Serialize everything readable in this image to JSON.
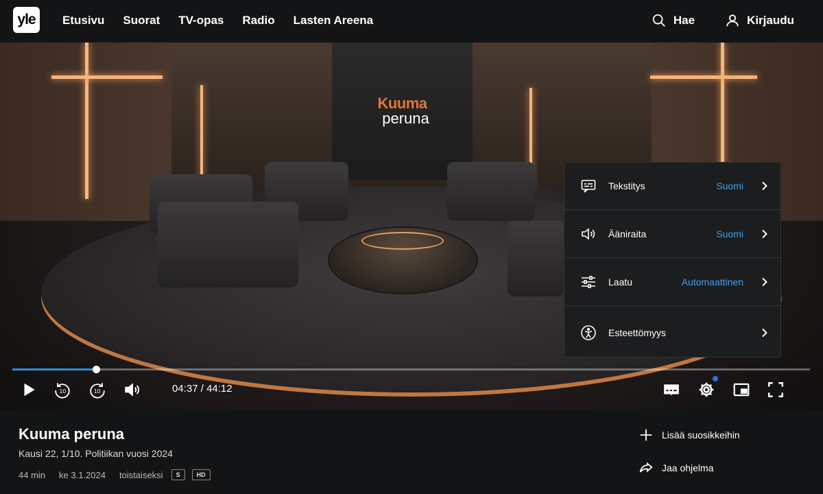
{
  "brand": {
    "logo_text": "yle"
  },
  "nav": {
    "items": [
      "Etusivu",
      "Suorat",
      "TV-opas",
      "Radio",
      "Lasten Areena"
    ],
    "search_label": "Hae",
    "login_label": "Kirjaudu"
  },
  "video": {
    "show_logo_line1": "Kuuma",
    "show_logo_line2": "peruna",
    "progress_fraction": 0.105,
    "current_time": "04:37",
    "time_separator": "/",
    "duration": "44:12"
  },
  "settings_menu": {
    "items": [
      {
        "icon": "subtitles-icon",
        "label": "Tekstitys",
        "value": "Suomi"
      },
      {
        "icon": "speaker-icon",
        "label": "Ääniraita",
        "value": "Suomi"
      },
      {
        "icon": "sliders-icon",
        "label": "Laatu",
        "value": "Automaattinen"
      },
      {
        "icon": "accessibility-icon",
        "label": "Esteettömyys",
        "value": ""
      }
    ]
  },
  "program": {
    "title": "Kuuma peruna",
    "subtitle": "Kausi 22, 1/10. Politiikan vuosi 2024",
    "duration": "44 min",
    "date": "ke 3.1.2024",
    "availability": "toistaiseksi",
    "badges": [
      "S",
      "HD"
    ]
  },
  "actions": {
    "favorite_label": "Lisää suosikkeihin",
    "share_label": "Jaa ohjelma"
  },
  "colors": {
    "accent": "#2d8ed8",
    "menu_value": "#3aa0ee",
    "background": "#131415"
  }
}
